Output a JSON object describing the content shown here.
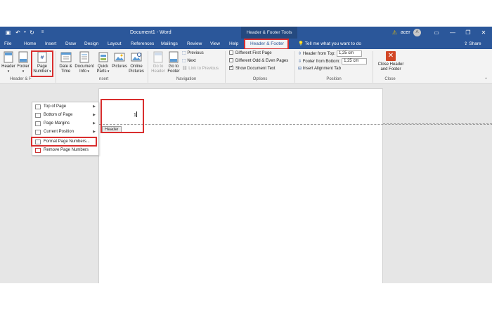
{
  "titlebar": {
    "document_title": "Document1 - Word",
    "contextual_tools": "Header & Footer Tools",
    "user_name": "acer",
    "avatar_letter": "A"
  },
  "tabs": {
    "items": [
      "File",
      "Home",
      "Insert",
      "Draw",
      "Design",
      "Layout",
      "References",
      "Mailings",
      "Review",
      "View",
      "Help"
    ],
    "active": "Header & Footer",
    "tell_me": "Tell me what you want to do",
    "share": "Share"
  },
  "ribbon": {
    "header_footer_group": {
      "header": "Header",
      "footer": "Footer",
      "page_number_line1": "Page",
      "page_number_line2": "Number",
      "label": "Header & F"
    },
    "insert_group": {
      "date_time_line1": "Date &",
      "date_time_line2": "Time",
      "doc_info_line1": "Document",
      "doc_info_line2": "Info",
      "quick_parts_line1": "Quick",
      "quick_parts_line2": "Parts",
      "pictures": "Pictures",
      "online_pictures_line1": "Online",
      "online_pictures_line2": "Pictures",
      "label": "nsert"
    },
    "navigation_group": {
      "go_to_header_line1": "Go to",
      "go_to_header_line2": "Header",
      "go_to_footer_line1": "Go to",
      "go_to_footer_line2": "Footer",
      "previous": "Previous",
      "next": "Next",
      "link_to_previous": "Link to Previous",
      "label": "Navigation"
    },
    "options_group": {
      "different_first_page": "Different First Page",
      "different_odd_even": "Different Odd & Even Pages",
      "show_document_text": "Show Document Text",
      "show_document_text_checked": true,
      "label": "Options"
    },
    "position_group": {
      "header_from_top": "Header from Top:",
      "header_from_top_value": "1,25 cm",
      "footer_from_bottom": "Footer from Bottom:",
      "footer_from_bottom_value": "1,25 cm",
      "insert_alignment_tab": "Insert Alignment Tab",
      "label": "Position"
    },
    "close_group": {
      "close_line1": "Close Header",
      "close_line2": "and Footer",
      "label": "Close"
    }
  },
  "menu": {
    "top_of_page": "Top of Page",
    "bottom_of_page": "Bottom of Page",
    "page_margins": "Page Margins",
    "current_position": "Current Position",
    "format_page_numbers": "Format Page Numbers...",
    "remove_page_numbers": "Remove Page Numbers"
  },
  "document": {
    "page_number_text": "1",
    "header_tag": "Header"
  },
  "colors": {
    "word_blue": "#2b579a",
    "highlight_red": "#d92e2e"
  }
}
